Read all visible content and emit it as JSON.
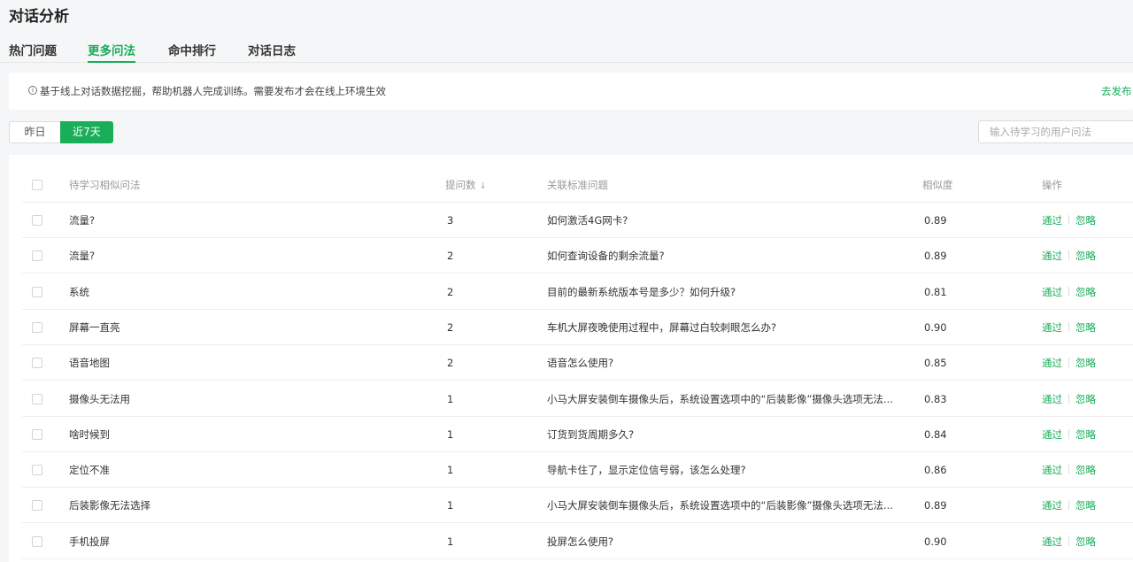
{
  "page": {
    "title": "对话分析"
  },
  "tabs": [
    "热门问题",
    "更多问法",
    "命中排行",
    "对话日志"
  ],
  "notice": {
    "text": "基于线上对话数据挖掘，帮助机器人完成训练。需要发布才会在线上环境生效",
    "link": "去发布"
  },
  "range": {
    "yesterday": "昨日",
    "week": "近7天",
    "selected": "近7天"
  },
  "search": {
    "placeholder": "输入待学习的用户问法",
    "value": ""
  },
  "table": {
    "headers": {
      "question": "待学习相似问法",
      "count": "提问数",
      "standard": "关联标准问题",
      "similarity": "相似度",
      "ops": "操作"
    },
    "actions": {
      "pass": "通过",
      "ignore": "忽略"
    },
    "rows": [
      {
        "question": "流量?",
        "count": "3",
        "standard": "如何激活4G网卡?",
        "similarity": "0.89"
      },
      {
        "question": "流量?",
        "count": "2",
        "standard": "如何查询设备的剩余流量?",
        "similarity": "0.89"
      },
      {
        "question": "系统",
        "count": "2",
        "standard": "目前的最新系统版本号是多少？如何升级?",
        "similarity": "0.81"
      },
      {
        "question": "屏幕一直亮",
        "count": "2",
        "standard": "车机大屏夜晚使用过程中，屏幕过白较刺眼怎么办?",
        "similarity": "0.90"
      },
      {
        "question": "语音地图",
        "count": "2",
        "standard": "语音怎么使用?",
        "similarity": "0.85"
      },
      {
        "question": "摄像头无法用",
        "count": "1",
        "standard": "小马大屏安装倒车摄像头后，系统设置选项中的“后装影像”摄像头选项无法...",
        "similarity": "0.83"
      },
      {
        "question": "啥时候到",
        "count": "1",
        "standard": "订货到货周期多久?",
        "similarity": "0.84"
      },
      {
        "question": "定位不准",
        "count": "1",
        "standard": "导航卡住了，显示定位信号弱，该怎么处理?",
        "similarity": "0.86"
      },
      {
        "question": "后装影像无法选择",
        "count": "1",
        "standard": "小马大屏安装倒车摄像头后，系统设置选项中的“后装影像”摄像头选项无法...",
        "similarity": "0.89"
      },
      {
        "question": "手机投屏",
        "count": "1",
        "standard": "投屏怎么使用?",
        "similarity": "0.90"
      }
    ]
  },
  "colors": {
    "accent": "#1aad5a",
    "background": "#f5f6f7"
  }
}
